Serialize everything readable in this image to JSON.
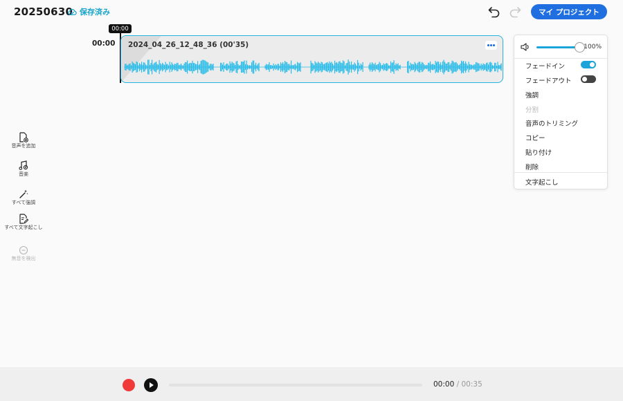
{
  "header": {
    "project_title": "20250630",
    "save_status": "保存済み",
    "my_projects_label": "マイ プロジェクト"
  },
  "timeline": {
    "playhead_time": "00:00",
    "track_start_time": "00:00",
    "clip": {
      "title": "2024_04_26_12_48_36 (00'35)"
    }
  },
  "clip_menu": {
    "volume_percent": 100,
    "volume_label": "100%",
    "items": [
      {
        "label": "フェードイン",
        "toggle": true,
        "enabled": true
      },
      {
        "label": "フェードアウト",
        "toggle": false,
        "enabled": true
      },
      {
        "label": "強調",
        "enabled": true
      },
      {
        "label": "分割",
        "enabled": false
      },
      {
        "label": "音声のトリミング",
        "enabled": true
      },
      {
        "label": "コピー",
        "enabled": true
      },
      {
        "label": "貼り付け",
        "enabled": true
      },
      {
        "label": "削除",
        "enabled": true
      },
      {
        "label": "文字起こし",
        "enabled": true
      }
    ]
  },
  "tools": [
    {
      "label": "音声を追加",
      "icon": "add-audio-file-icon",
      "enabled": true
    },
    {
      "label": "音楽",
      "icon": "music-icon",
      "enabled": true
    },
    {
      "label": "すべて強調",
      "icon": "magic-wand-icon",
      "enabled": true
    },
    {
      "label": "すべて文字起こし",
      "icon": "transcribe-doc-icon",
      "enabled": true
    },
    {
      "label": "無音を検出",
      "icon": "silence-detect-icon",
      "enabled": false
    }
  ],
  "player": {
    "current_time": "00:00",
    "separator": "/",
    "total_time": "00:35",
    "progress": 0
  },
  "colors": {
    "accent": "#1aa4d9",
    "primary_button": "#1f6fe0",
    "record": "#f03a3a",
    "waveform": "#29bce8"
  }
}
